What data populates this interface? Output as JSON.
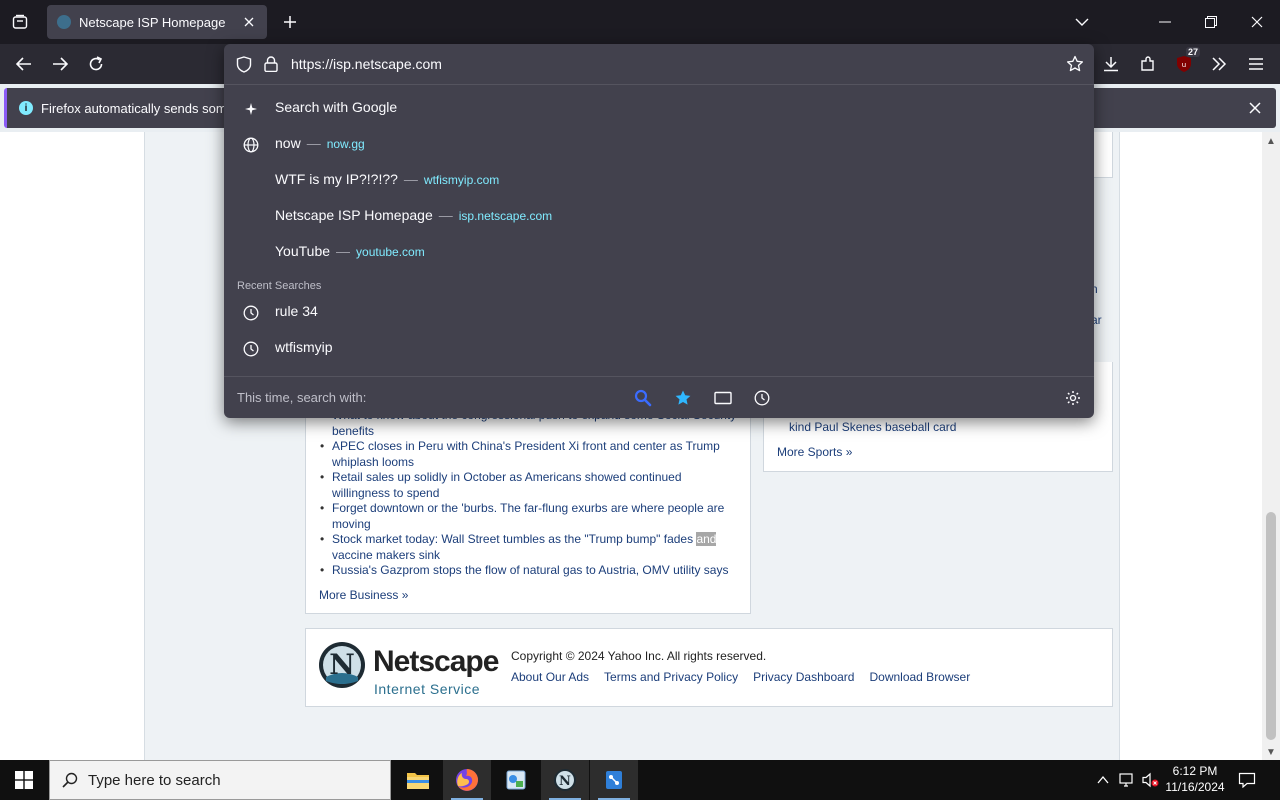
{
  "browser": {
    "tab_title": "Netscape ISP Homepage",
    "url": "https://isp.netscape.com",
    "extensions_badge": "27",
    "infobar_text": "Firefox automatically sends some d"
  },
  "dropdown": {
    "suggestions": [
      {
        "title": "Search with Google",
        "site": ""
      },
      {
        "title": "now",
        "site": "now.gg"
      },
      {
        "title": "WTF is my IP?!?!??",
        "site": "wtfismyip.com"
      },
      {
        "title": "Netscape ISP Homepage",
        "site": "isp.netscape.com"
      },
      {
        "title": "YouTube",
        "site": "youtube.com"
      }
    ],
    "recent_heading": "Recent Searches",
    "recent": [
      {
        "title": "rule 34"
      },
      {
        "title": "wtfismyip"
      }
    ],
    "search_with_label": "This time, search with:"
  },
  "page": {
    "business_news": [
      "What to know about the congressional push to expand some Social Security benefits",
      "APEC closes in Peru with China's President Xi front and center as Trump whiplash looms",
      "Retail sales up solidly in October as Americans showed continued willingness to spend",
      "Forget downtown or the 'burbs. The far-flung exurbs are where people are moving",
      "Stock market today: Wall Street tumbles as the \"Trump bump\" fades",
      "Russia's Gazprom stops the flow of natural gas to Austria, OMV utility says"
    ],
    "business_news_highlight": "and",
    "business_news_tail": "vaccine makers sink",
    "more_business": "More Business »",
    "sports_partial_1": "kind Paul Skenes baseball card",
    "sports_edge_1": "n",
    "sports_edge_2": "ar",
    "more_sports": "More Sports »",
    "footer": {
      "logo_text": "Netscape",
      "logo_sub": "Internet Service",
      "copyright": "Copyright © 2024 Yahoo Inc. All rights reserved.",
      "links": [
        "About Our Ads",
        "Terms and Privacy Policy",
        "Privacy Dashboard",
        "Download Browser"
      ]
    }
  },
  "taskbar": {
    "search_placeholder": "Type here to search",
    "time": "6:12 PM",
    "date": "11/16/2024"
  },
  "colors": {
    "accent_link": "#80ebff",
    "page_link": "#1c3e7a",
    "chrome_dark": "#1c1b22",
    "dropdown_bg": "#42414d"
  }
}
